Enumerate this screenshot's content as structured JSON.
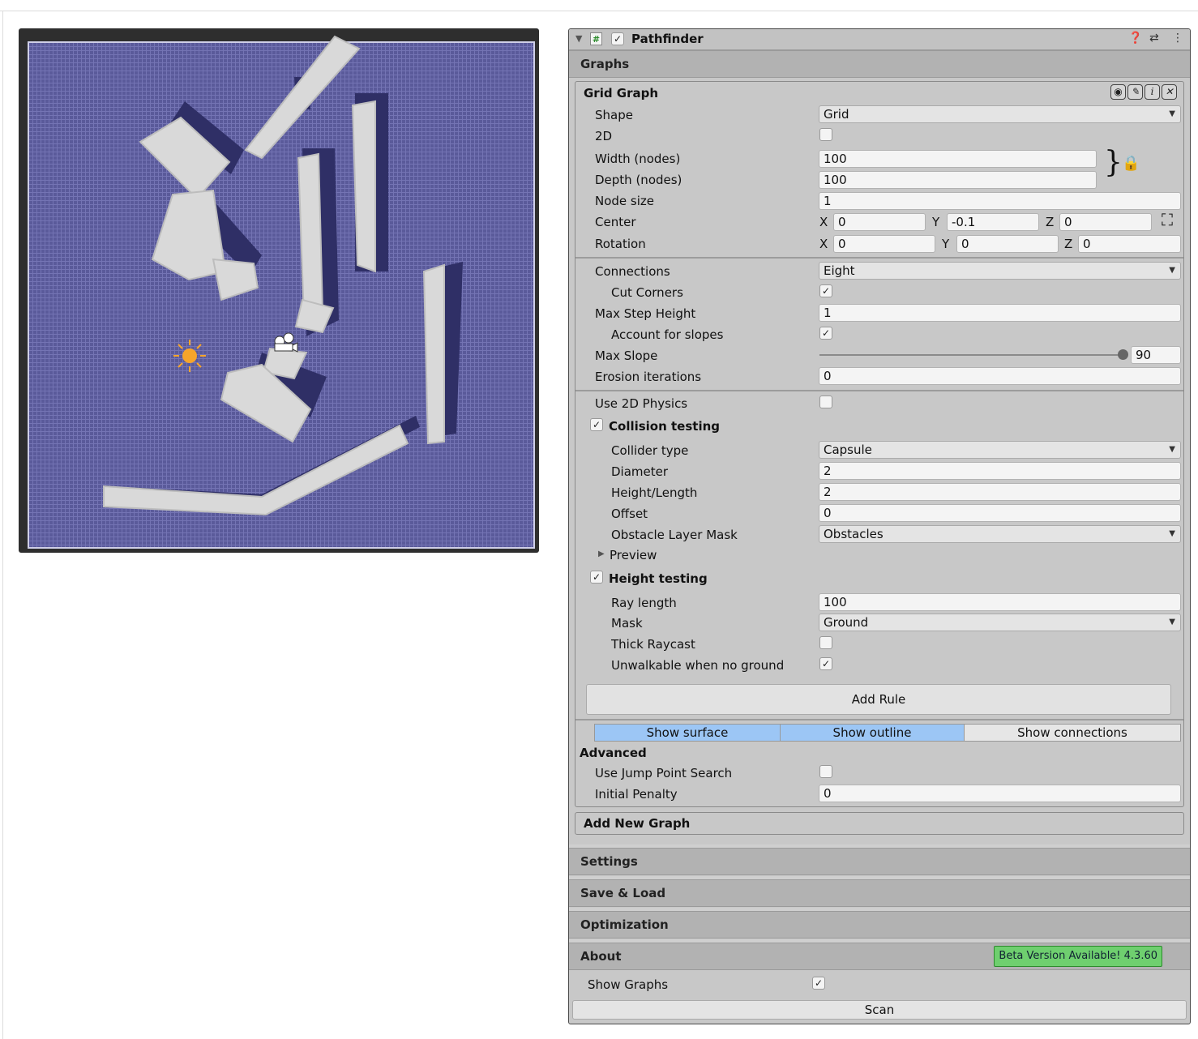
{
  "component": {
    "title": "Pathfinder",
    "icons": [
      "help-icon",
      "preset-icon",
      "kebab-menu-icon"
    ]
  },
  "sections": {
    "graphs": "Graphs",
    "settings": "Settings",
    "save_load": "Save & Load",
    "optimization": "Optimization",
    "about": "About"
  },
  "grid_graph": {
    "title": "Grid Graph",
    "icons": [
      "eye-icon",
      "pencil-icon",
      "info-icon",
      "close-icon"
    ],
    "shape": {
      "label": "Shape",
      "value": "Grid"
    },
    "two_d": {
      "label": "2D",
      "checked": false
    },
    "width": {
      "label": "Width (nodes)",
      "value": "100"
    },
    "depth": {
      "label": "Depth (nodes)",
      "value": "100"
    },
    "node_size": {
      "label": "Node size",
      "value": "1"
    },
    "center": {
      "label": "Center",
      "x": "0",
      "y": "-0.1",
      "z": "0"
    },
    "rotation": {
      "label": "Rotation",
      "x": "0",
      "y": "0",
      "z": "0"
    },
    "axes": {
      "x": "X",
      "y": "Y",
      "z": "Z"
    },
    "connections": {
      "label": "Connections",
      "value": "Eight"
    },
    "cut_corners": {
      "label": "Cut Corners",
      "checked": true
    },
    "max_step_height": {
      "label": "Max Step Height",
      "value": "1"
    },
    "account_for_slopes": {
      "label": "Account for slopes",
      "checked": true
    },
    "max_slope": {
      "label": "Max Slope",
      "value": "90",
      "fraction": 1.0
    },
    "erosion": {
      "label": "Erosion iterations",
      "value": "0"
    },
    "use_2d_physics": {
      "label": "Use 2D Physics",
      "checked": false
    },
    "collision_testing": {
      "label": "Collision testing",
      "checked": true
    },
    "collider_type": {
      "label": "Collider type",
      "value": "Capsule"
    },
    "diameter": {
      "label": "Diameter",
      "value": "2"
    },
    "height_length": {
      "label": "Height/Length",
      "value": "2"
    },
    "offset": {
      "label": "Offset",
      "value": "0"
    },
    "obstacle_mask": {
      "label": "Obstacle Layer Mask",
      "value": "Obstacles"
    },
    "preview": {
      "label": "Preview"
    },
    "height_testing": {
      "label": "Height testing",
      "checked": true
    },
    "ray_length": {
      "label": "Ray length",
      "value": "100"
    },
    "mask": {
      "label": "Mask",
      "value": "Ground"
    },
    "thick_raycast": {
      "label": "Thick Raycast",
      "checked": false
    },
    "unwalkable_no_ground": {
      "label": "Unwalkable when no ground",
      "checked": true
    },
    "add_rule": "Add Rule",
    "show_surface": "Show surface",
    "show_outline": "Show outline",
    "show_connections": "Show connections",
    "advanced": "Advanced",
    "jump_point": {
      "label": "Use Jump Point Search",
      "checked": false
    },
    "initial_penalty": {
      "label": "Initial Penalty",
      "value": "0"
    }
  },
  "add_new_graph": "Add New Graph",
  "about": {
    "beta_badge": "Beta Version Available! 4.3.60",
    "show_graphs": {
      "label": "Show Graphs",
      "checked": true
    },
    "scan": "Scan"
  },
  "colors": {
    "grid": "#5c5c9c",
    "obstacle": "#d8d8d8",
    "shadow": "#34346e",
    "segment_active": "#9cc6f5",
    "beta_badge": "#6fcf6f"
  }
}
